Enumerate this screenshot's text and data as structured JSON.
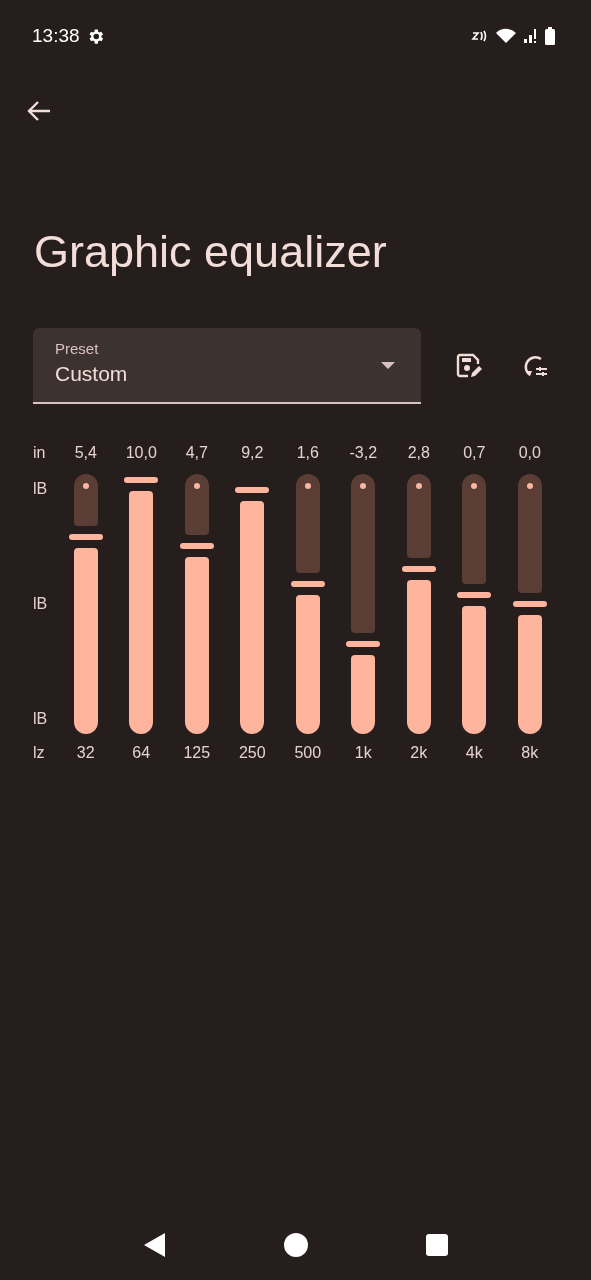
{
  "status_bar": {
    "time": "13:38"
  },
  "title": "Graphic equalizer",
  "preset": {
    "label": "Preset",
    "value": "Custom"
  },
  "axis_labels": {
    "gain": "in",
    "top": "lB",
    "middle": "lB",
    "bottom": "lB",
    "frequency": "lz"
  },
  "bands": [
    {
      "gain": "5,4",
      "frequency": "32",
      "level": 0.77
    },
    {
      "gain": "10,0",
      "frequency": "64",
      "level": 1.0
    },
    {
      "gain": "4,7",
      "frequency": "125",
      "level": 0.735
    },
    {
      "gain": "9,2",
      "frequency": "250",
      "level": 0.96
    },
    {
      "gain": "1,6",
      "frequency": "500",
      "level": 0.58
    },
    {
      "gain": "-3,2",
      "frequency": "1k",
      "level": 0.34
    },
    {
      "gain": "2,8",
      "frequency": "2k",
      "level": 0.64
    },
    {
      "gain": "0,7",
      "frequency": "4k",
      "level": 0.535
    },
    {
      "gain": "0,0",
      "frequency": "8k",
      "level": 0.5
    }
  ]
}
